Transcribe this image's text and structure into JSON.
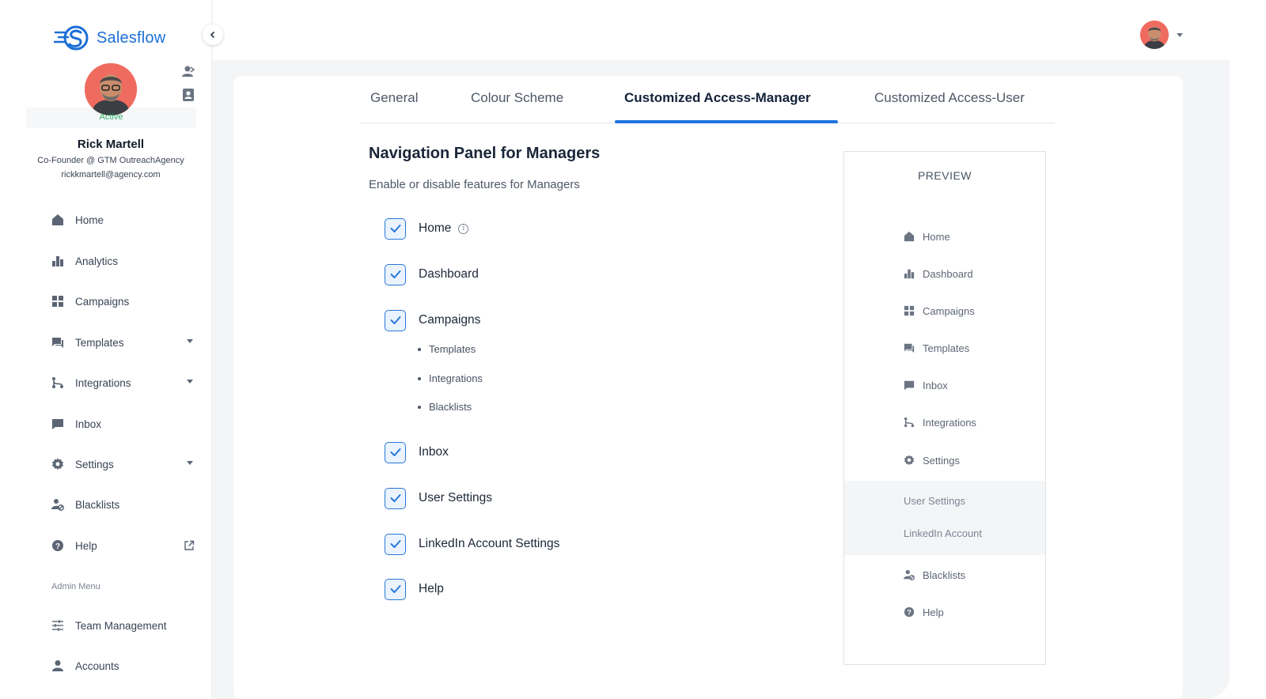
{
  "brand": {
    "name": "Salesflow",
    "color": "#1b6fd6"
  },
  "profile": {
    "status": "Active",
    "name": "Rick Martell",
    "role": "Co-Founder @ GTM OutreachAgency",
    "email": "rickkmartell@agency.com"
  },
  "sidebar": {
    "items": [
      {
        "label": "Home",
        "icon": "home-icon"
      },
      {
        "label": "Analytics",
        "icon": "bar-chart-icon"
      },
      {
        "label": "Campaigns",
        "icon": "grid-icon"
      },
      {
        "label": "Templates",
        "icon": "chat-icon",
        "has_dropdown": true
      },
      {
        "label": "Integrations",
        "icon": "branch-icon",
        "has_dropdown": true
      },
      {
        "label": "Inbox",
        "icon": "message-icon"
      },
      {
        "label": "Settings",
        "icon": "gear-icon",
        "has_dropdown": true
      },
      {
        "label": "Blacklists",
        "icon": "user-block-icon"
      },
      {
        "label": "Help",
        "icon": "help-icon",
        "external": true
      }
    ],
    "admin_label": "Admin Menu",
    "admin_items": [
      {
        "label": "Team Management",
        "icon": "sliders-icon"
      },
      {
        "label": "Accounts",
        "icon": "person-icon"
      }
    ]
  },
  "tabs": [
    {
      "label": "General",
      "active": false
    },
    {
      "label": "Colour Scheme",
      "active": false
    },
    {
      "label": "Customized Access-Manager",
      "active": true
    },
    {
      "label": "Customized Access-User",
      "active": false
    }
  ],
  "section": {
    "title": "Navigation Panel for Managers",
    "subtitle": "Enable or disable features for Managers"
  },
  "features": [
    {
      "label": "Home",
      "checked": true,
      "info": true
    },
    {
      "label": "Dashboard",
      "checked": true
    },
    {
      "label": "Campaigns",
      "checked": true,
      "sub_items": [
        "Templates",
        "Integrations",
        "Blacklists"
      ]
    },
    {
      "label": "Inbox",
      "checked": true
    },
    {
      "label": "User Settings",
      "checked": true
    },
    {
      "label": "LinkedIn Account Settings",
      "checked": true
    },
    {
      "label": "Help",
      "checked": true
    }
  ],
  "preview": {
    "title": "PREVIEW",
    "items": [
      {
        "label": "Home",
        "icon": "home-icon"
      },
      {
        "label": "Dashboard",
        "icon": "bar-chart-icon"
      },
      {
        "label": "Campaigns",
        "icon": "grid-icon"
      },
      {
        "label": "Templates",
        "icon": "chat-icon"
      },
      {
        "label": "Inbox",
        "icon": "message-icon"
      },
      {
        "label": "Integrations",
        "icon": "branch-icon"
      },
      {
        "label": "Settings",
        "icon": "gear-icon"
      }
    ],
    "settings_sub": [
      "User Settings",
      "LinkedIn Account"
    ],
    "bottom_items": [
      {
        "label": "Blacklists",
        "icon": "user-block-icon"
      },
      {
        "label": "Help",
        "icon": "help-icon"
      }
    ]
  },
  "colors": {
    "accent": "#1f74dd",
    "active_status": "#2fb36a",
    "avatar_bg": "#ef6b5f"
  }
}
